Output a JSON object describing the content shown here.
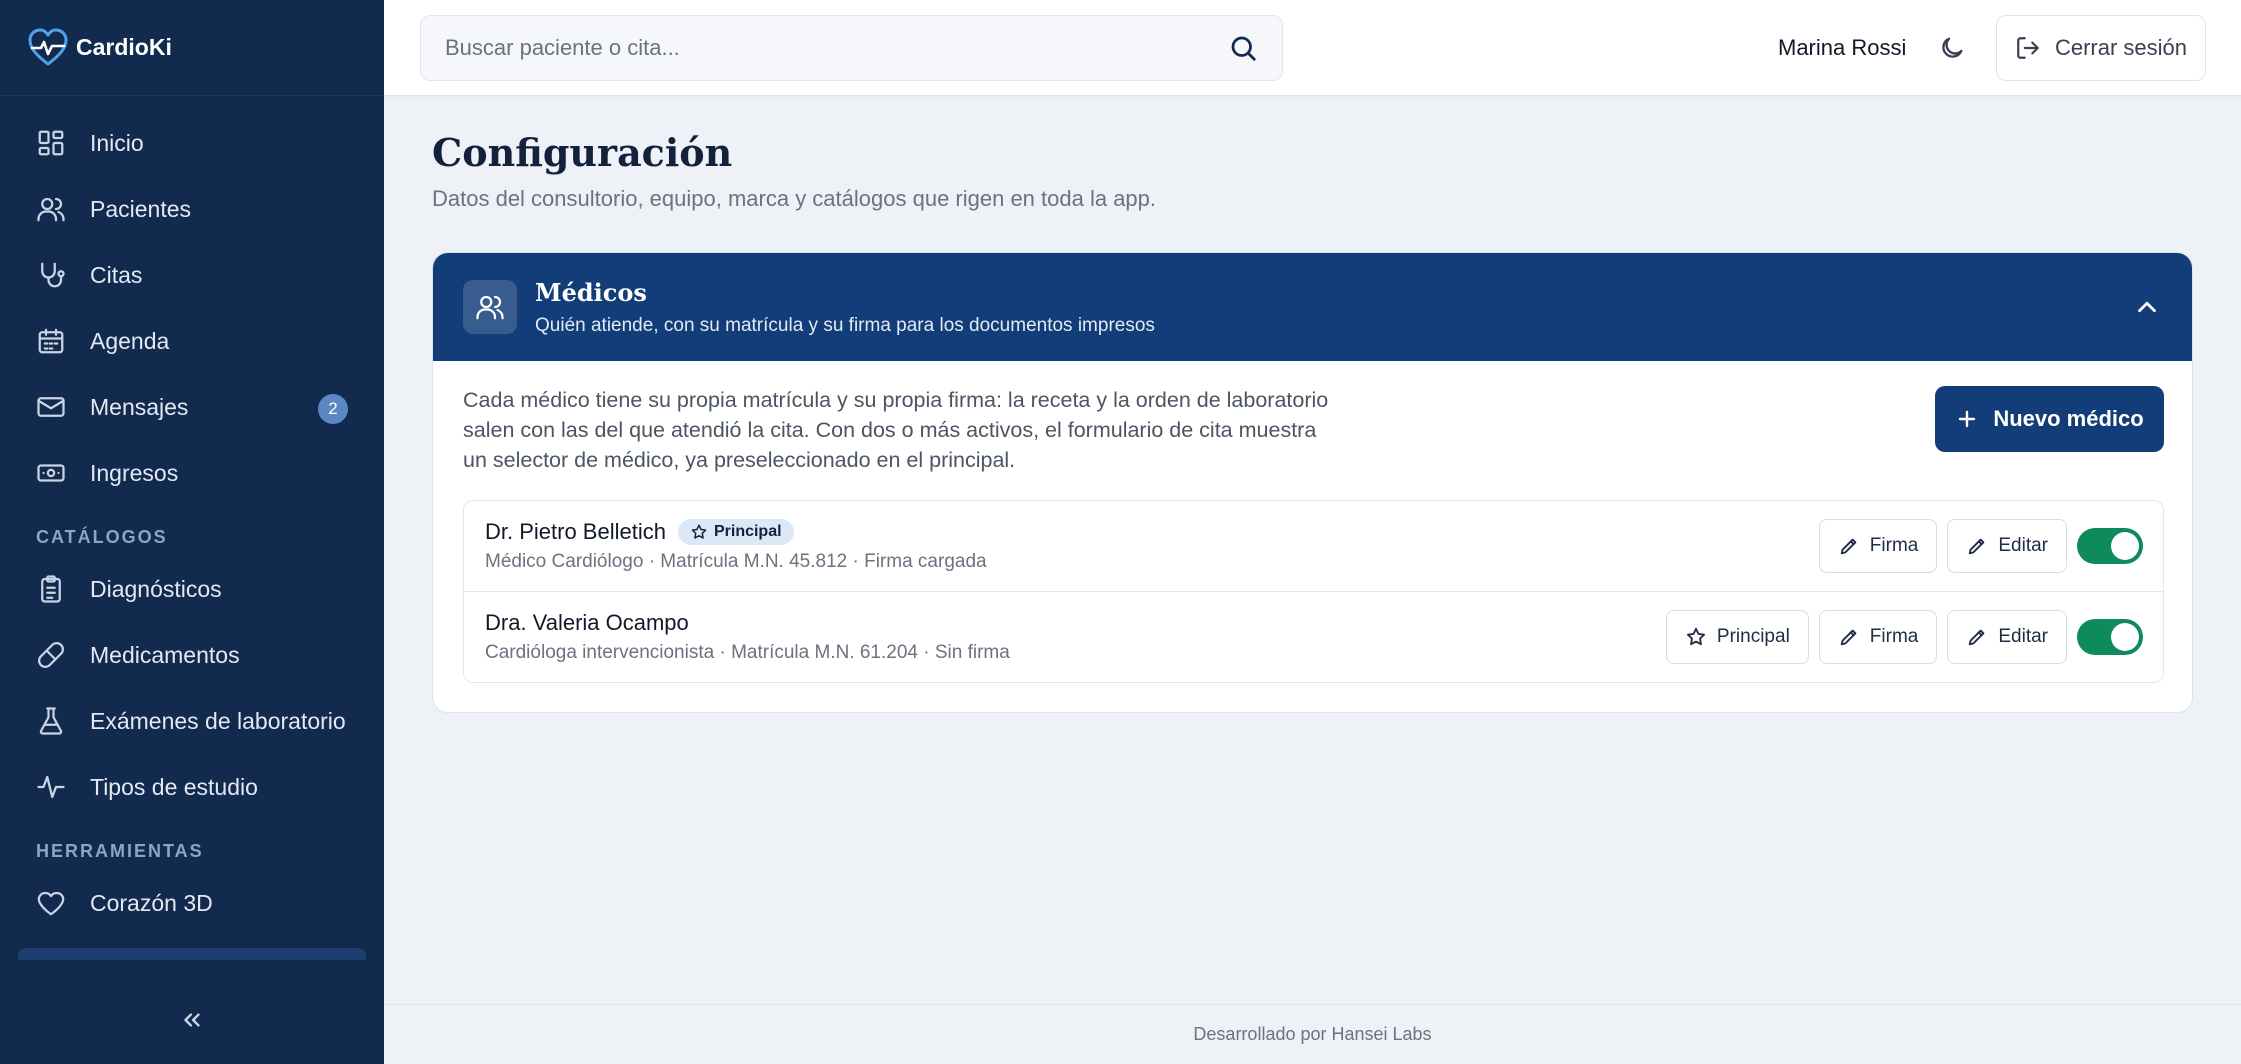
{
  "app": {
    "name": "CardioKi"
  },
  "sidebar": {
    "items": [
      {
        "label": "Inicio",
        "icon": "grid-icon"
      },
      {
        "label": "Pacientes",
        "icon": "users-icon"
      },
      {
        "label": "Citas",
        "icon": "stethoscope-icon"
      },
      {
        "label": "Agenda",
        "icon": "calendar-icon"
      },
      {
        "label": "Mensajes",
        "icon": "mail-icon",
        "badge": "2"
      },
      {
        "label": "Ingresos",
        "icon": "banknote-icon"
      }
    ],
    "section_catalogs": "CATÁLOGOS",
    "catalogs": [
      {
        "label": "Diagnósticos",
        "icon": "clipboard-icon"
      },
      {
        "label": "Medicamentos",
        "icon": "pill-icon"
      },
      {
        "label": "Exámenes de laboratorio",
        "icon": "flask-icon"
      },
      {
        "label": "Tipos de estudio",
        "icon": "activity-icon"
      }
    ],
    "section_tools": "HERRAMIENTAS",
    "tools": [
      {
        "label": "Corazón 3D",
        "icon": "heart-icon"
      }
    ]
  },
  "topbar": {
    "search_placeholder": "Buscar paciente o cita...",
    "user_name": "Marina Rossi",
    "logout_label": "Cerrar sesión"
  },
  "main": {
    "title": "Configuración",
    "subtitle": "Datos del consultorio, equipo, marca y catálogos que rigen en toda la app.",
    "section": {
      "title": "Médicos",
      "subtitle": "Quién atiende, con su matrícula y su firma para los documentos impresos",
      "intro": "Cada médico tiene su propia matrícula y su propia firma: la receta y la orden de laboratorio salen con las del que atendió la cita. Con dos o más activos, el formulario de cita muestra un selector de médico, ya preseleccionado en el principal.",
      "new_button": "Nuevo médico",
      "doctors": [
        {
          "name": "Dr. Pietro Belletich",
          "badge": "Principal",
          "meta": "Médico Cardiólogo · Matrícula M.N. 45.812 · Firma cargada",
          "active": true
        },
        {
          "name": "Dra. Valeria Ocampo",
          "meta": "Cardióloga intervencionista · Matrícula M.N. 61.204 · Sin firma",
          "principal_button": "Principal",
          "active": true
        }
      ],
      "sign_label": "Firma",
      "edit_label": "Editar"
    }
  },
  "footer": {
    "text": "Desarrollado por Hansei Labs"
  },
  "colors": {
    "sidebar": "#112a4d",
    "accent": "#133d78",
    "toggle_on": "#0f8a5a"
  }
}
